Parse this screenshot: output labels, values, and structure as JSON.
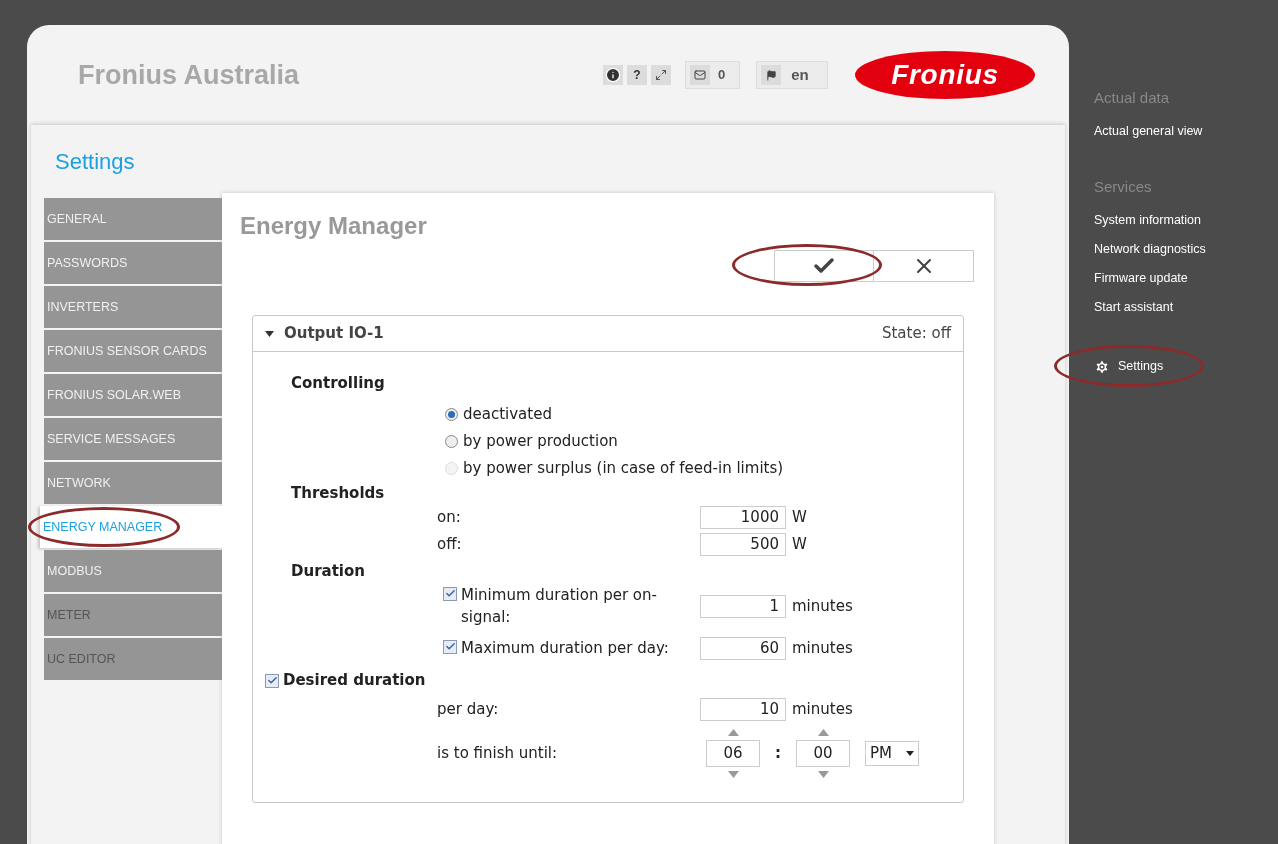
{
  "header": {
    "title": "Fronius Australia",
    "tools": [
      {
        "kind": "info"
      },
      {
        "kind": "help",
        "text": "?"
      },
      {
        "kind": "fullscreen"
      }
    ],
    "messages": {
      "count": "0"
    },
    "language": {
      "code": "en"
    },
    "logo": {
      "text": "Fronius"
    }
  },
  "settings": {
    "title": "Settings",
    "tabs": [
      {
        "label": "GENERAL",
        "selected": false,
        "dim": false,
        "highlighted": false
      },
      {
        "label": "PASSWORDS",
        "selected": false,
        "dim": false,
        "highlighted": false
      },
      {
        "label": "INVERTERS",
        "selected": false,
        "dim": false,
        "highlighted": false
      },
      {
        "label": "FRONIUS SENSOR CARDS",
        "selected": false,
        "dim": false,
        "highlighted": false
      },
      {
        "label": "FRONIUS SOLAR.WEB",
        "selected": false,
        "dim": false,
        "highlighted": false
      },
      {
        "label": "SERVICE MESSAGES",
        "selected": false,
        "dim": false,
        "highlighted": false
      },
      {
        "label": "NETWORK",
        "selected": false,
        "dim": false,
        "highlighted": false
      },
      {
        "label": "ENERGY MANAGER",
        "selected": true,
        "dim": false,
        "highlighted": true
      },
      {
        "label": "MODBUS",
        "selected": false,
        "dim": false,
        "highlighted": false
      },
      {
        "label": "METER",
        "selected": false,
        "dim": true,
        "highlighted": false
      },
      {
        "label": "UC EDITOR",
        "selected": false,
        "dim": true,
        "highlighted": false
      }
    ]
  },
  "energy_manager": {
    "title": "Energy Manager",
    "confirm": {
      "highlighted": true
    },
    "output": {
      "title": "Output IO-1",
      "expanded": true,
      "state_label": "State:",
      "state": "off",
      "controlling": {
        "heading": "Controlling",
        "options": [
          {
            "label": "deactivated",
            "selected": true,
            "disabled": false
          },
          {
            "label": "by power production",
            "selected": false,
            "disabled": false
          },
          {
            "label": "by power surplus (in case of feed-in limits)",
            "selected": false,
            "disabled": true
          }
        ]
      },
      "thresholds": {
        "heading": "Thresholds",
        "rows": [
          {
            "label": "on:",
            "value": "1000",
            "unit": "W"
          },
          {
            "label": "off:",
            "value": "500",
            "unit": "W"
          }
        ]
      },
      "duration": {
        "heading": "Duration",
        "rows": [
          {
            "label": "Minimum duration per on-signal:",
            "checked": true,
            "value": "1",
            "unit": "minutes"
          },
          {
            "label": "Maximum duration per day:",
            "checked": true,
            "value": "60",
            "unit": "minutes"
          }
        ]
      },
      "desired": {
        "heading": "Desired duration",
        "checked": true,
        "per_day": {
          "label": "per day:",
          "value": "10",
          "unit": "minutes"
        },
        "finish": {
          "label": "is to finish until:",
          "hour": "06",
          "separator": ":",
          "minute": "00",
          "period": "PM"
        }
      }
    }
  },
  "sidebar": {
    "sections": [
      {
        "heading": "Actual data",
        "items": [
          {
            "label": "Actual general view",
            "icon": false,
            "highlighted": false
          }
        ]
      },
      {
        "heading": "Services",
        "items": [
          {
            "label": "System information",
            "icon": false,
            "highlighted": false
          },
          {
            "label": "Network diagnostics",
            "icon": false,
            "highlighted": false
          },
          {
            "label": "Firmware update",
            "icon": false,
            "highlighted": false
          },
          {
            "label": "Start assistant",
            "icon": false,
            "highlighted": false
          }
        ]
      },
      {
        "items": [
          {
            "label": "Settings",
            "icon": true,
            "highlighted": true
          }
        ]
      }
    ]
  }
}
